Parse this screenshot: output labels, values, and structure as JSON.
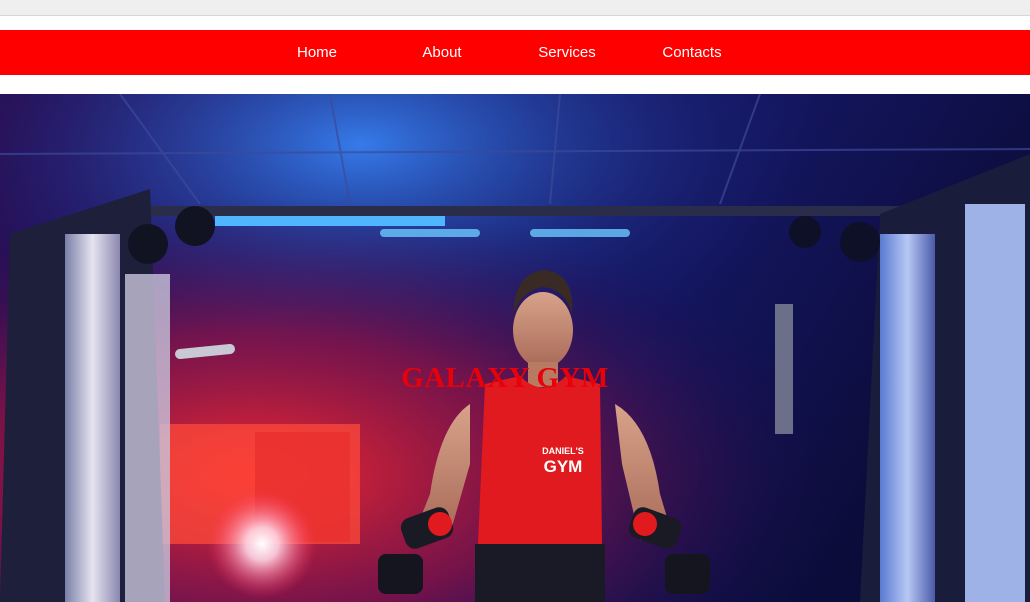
{
  "nav": {
    "items": [
      {
        "label": "Home"
      },
      {
        "label": "About"
      },
      {
        "label": "Services"
      },
      {
        "label": "Contacts"
      }
    ],
    "background": "#ff0000",
    "text_color": "#ffffff"
  },
  "hero": {
    "title": "GALAXY GYM",
    "title_color": "#e8000b",
    "shirt_text": [
      "DANIEL'S",
      "GYM"
    ]
  }
}
